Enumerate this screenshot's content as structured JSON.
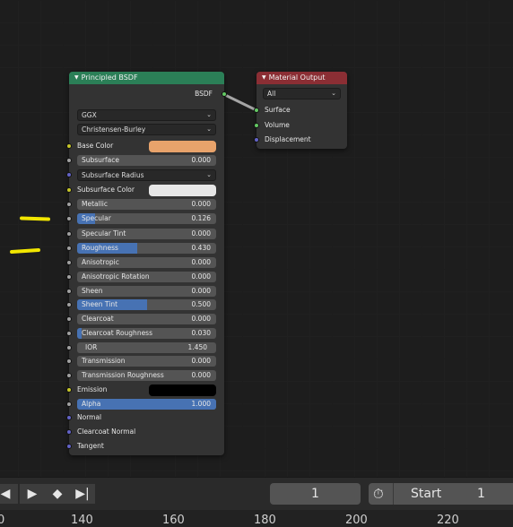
{
  "principled_node": {
    "title": "Principled BSDF",
    "output": "BSDF",
    "distribution": "GGX",
    "subsurface_method": "Christensen-Burley",
    "subsurface_radius": "Subsurface Radius",
    "color_labels": {
      "base_color": "Base Color",
      "subsurface_color": "Subsurface Color",
      "emission": "Emission"
    },
    "colors": {
      "base_color": "#e8a36b",
      "subsurface_color": "#e6e6e6",
      "emission": "#000000"
    },
    "fields": [
      {
        "label": "Subsurface",
        "value": "0.000",
        "fraction": 0
      },
      {
        "label": "Metallic",
        "value": "0.000",
        "fraction": 0
      },
      {
        "label": "Specular",
        "value": "0.126",
        "fraction": 0.126
      },
      {
        "label": "Specular Tint",
        "value": "0.000",
        "fraction": 0
      },
      {
        "label": "Roughness",
        "value": "0.430",
        "fraction": 0.43
      },
      {
        "label": "Anisotropic",
        "value": "0.000",
        "fraction": 0
      },
      {
        "label": "Anisotropic Rotation",
        "value": "0.000",
        "fraction": 0
      },
      {
        "label": "Sheen",
        "value": "0.000",
        "fraction": 0
      },
      {
        "label": "Sheen Tint",
        "value": "0.500",
        "fraction": 0.5
      },
      {
        "label": "Clearcoat",
        "value": "0.000",
        "fraction": 0
      },
      {
        "label": "Clearcoat Roughness",
        "value": "0.030",
        "fraction": 0.03
      },
      {
        "label": "IOR",
        "value": "1.450",
        "fraction": 0
      },
      {
        "label": "Transmission",
        "value": "0.000",
        "fraction": 0
      },
      {
        "label": "Transmission Roughness",
        "value": "0.000",
        "fraction": 0
      },
      {
        "label": "Alpha",
        "value": "1.000",
        "fraction": 1
      }
    ],
    "inputs": {
      "normal": "Normal",
      "clearcoat_normal": "Clearcoat Normal",
      "tangent": "Tangent"
    }
  },
  "output_node": {
    "title": "Material Output",
    "target": "All",
    "inputs": [
      "Surface",
      "Volume",
      "Displacement"
    ]
  },
  "timeline": {
    "current_frame": "1",
    "start_label": "Start",
    "start_value": "1"
  },
  "ruler": {
    "ticks": [
      "0",
      "140",
      "160",
      "180",
      "200",
      "220"
    ]
  }
}
